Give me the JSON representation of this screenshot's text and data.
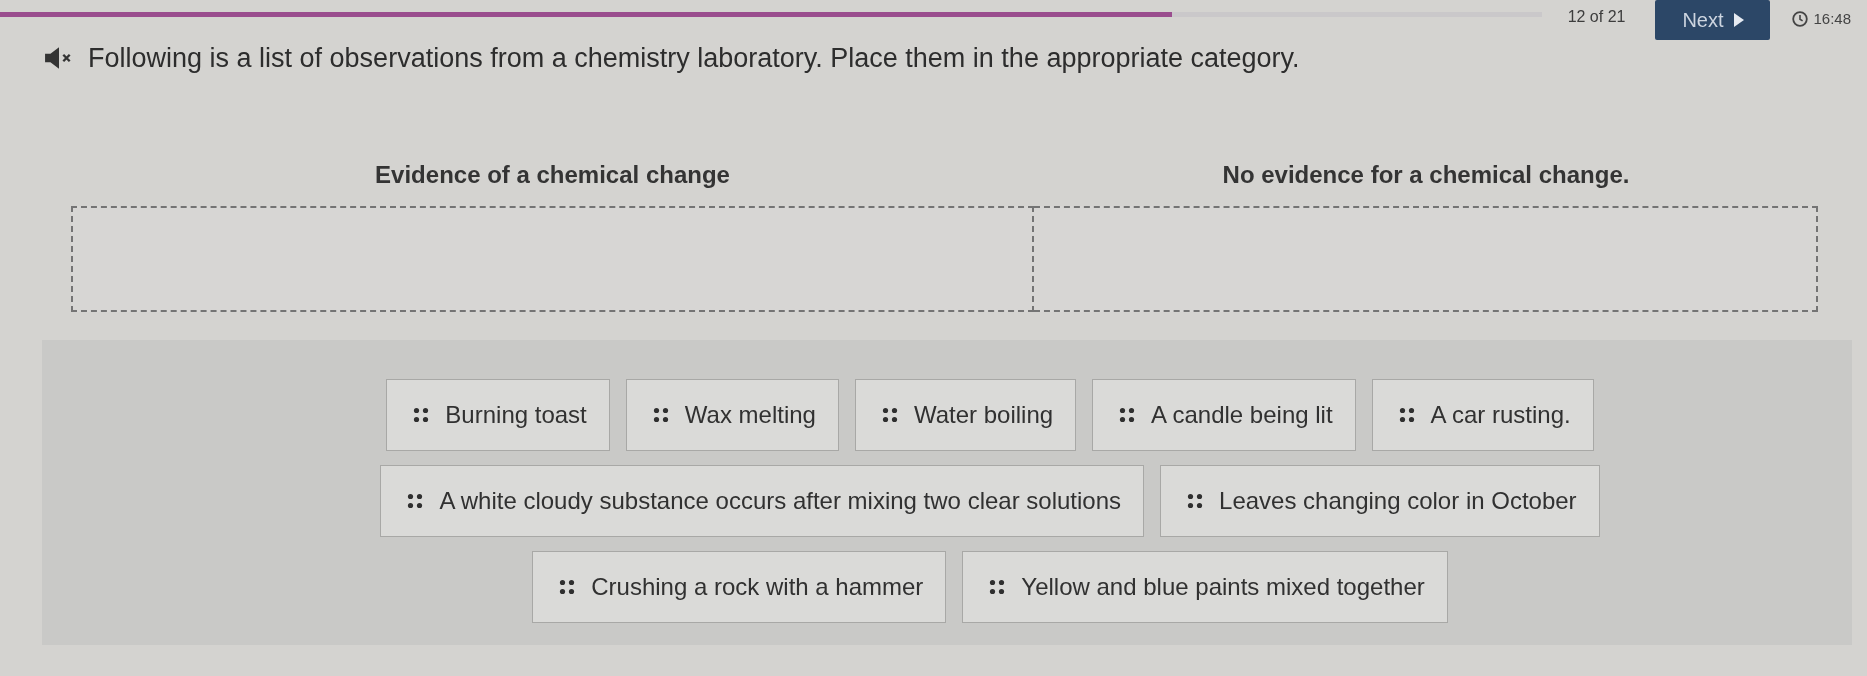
{
  "progress": {
    "level": 0.76
  },
  "navigation": {
    "question_counter": "12 of 21",
    "next_button": "Next",
    "timer": "16:48"
  },
  "question": {
    "prompt": "Following is a list of observations from a chemistry laboratory. Place them in the appropriate category."
  },
  "categories": [
    {
      "title": "Evidence of a chemical change"
    },
    {
      "title": "No evidence for a chemical change."
    }
  ],
  "answer_options": [
    {
      "label": "Burning toast"
    },
    {
      "label": "Wax melting"
    },
    {
      "label": "Water boiling"
    },
    {
      "label": "A candle being lit"
    },
    {
      "label": "A car rusting."
    },
    {
      "label": "A white cloudy substance occurs after mixing two clear solutions"
    },
    {
      "label": "Leaves changing color in October"
    },
    {
      "label": "Crushing a rock with a hammer"
    },
    {
      "label": "Yellow and blue paints mixed together"
    }
  ]
}
